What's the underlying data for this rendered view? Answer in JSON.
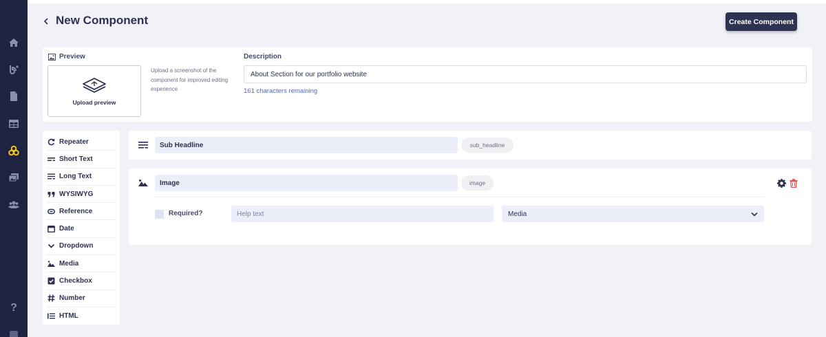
{
  "header": {
    "title": "New Component",
    "create_button": "Create Component"
  },
  "preview": {
    "label": "Preview",
    "upload_label": "Upload preview",
    "hint": "Upload a screenshot of the component for improved editing experience"
  },
  "description": {
    "label": "Description",
    "value": "About Section for our portfolio website",
    "remaining": "161 characters remaining"
  },
  "field_types": [
    {
      "label": "Repeater",
      "icon": "repeat-icon"
    },
    {
      "label": "Short Text",
      "icon": "short-text-icon"
    },
    {
      "label": "Long Text",
      "icon": "long-text-icon"
    },
    {
      "label": "WYSIWYG",
      "icon": "quote-icon"
    },
    {
      "label": "Reference",
      "icon": "link-icon"
    },
    {
      "label": "Date",
      "icon": "calendar-icon"
    },
    {
      "label": "Dropdown",
      "icon": "chevron-down-icon"
    },
    {
      "label": "Media",
      "icon": "image-icon"
    },
    {
      "label": "Checkbox",
      "icon": "checkbox-icon"
    },
    {
      "label": "Number",
      "icon": "hash-icon"
    },
    {
      "label": "HTML",
      "icon": "list-icon"
    }
  ],
  "fields": [
    {
      "name": "Sub Headline",
      "key": "sub_headline",
      "icon": "long-text-icon"
    },
    {
      "name": "Image",
      "key": "image",
      "icon": "image-icon",
      "required_label": "Required?",
      "help_placeholder": "Help text",
      "type_value": "Media"
    }
  ],
  "colors": {
    "sidebar": "#1d2341",
    "accent": "#5b6bb0",
    "active_nav": "#f5c518",
    "delete": "#d9534f"
  }
}
